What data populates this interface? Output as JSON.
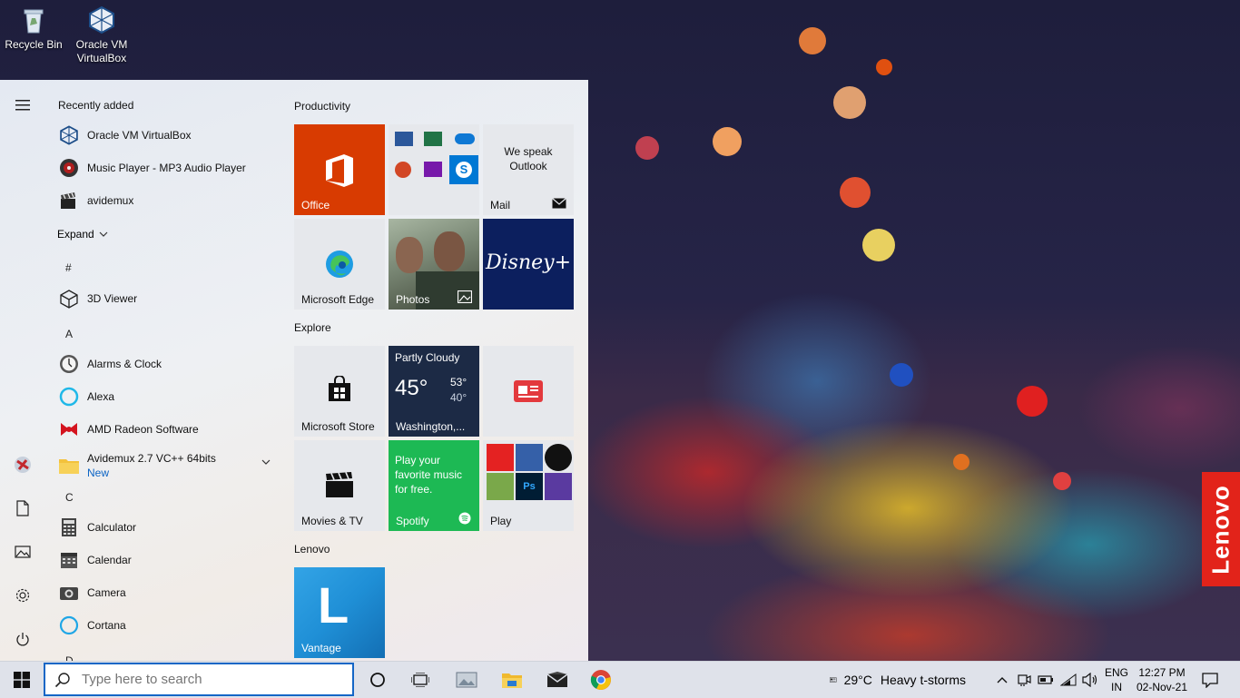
{
  "desktop": {
    "icons": [
      {
        "label": "Recycle Bin"
      },
      {
        "label": "Oracle VM VirtualBox"
      }
    ],
    "badge": "Lenovo"
  },
  "start_menu": {
    "recent_title": "Recently added",
    "recent": [
      {
        "name": "Oracle VM VirtualBox"
      },
      {
        "name": "Music Player - MP3 Audio Player"
      },
      {
        "name": "avidemux"
      }
    ],
    "expand_label": "Expand",
    "letters": [
      "#",
      "A",
      "C",
      "D"
    ],
    "apps": [
      {
        "name": "3D Viewer"
      },
      {
        "name": "Alarms & Clock"
      },
      {
        "name": "Alexa"
      },
      {
        "name": "AMD Radeon Software"
      },
      {
        "name": "Avidemux 2.7 VC++ 64bits",
        "badge": "New"
      },
      {
        "name": "Calculator"
      },
      {
        "name": "Calendar"
      },
      {
        "name": "Camera"
      },
      {
        "name": "Cortana"
      }
    ],
    "groups": {
      "productivity": "Productivity",
      "explore": "Explore",
      "lenovo": "Lenovo"
    },
    "tiles": {
      "office": "Office",
      "mail_promo": "We speak Outlook",
      "mail": "Mail",
      "edge": "Microsoft Edge",
      "photos": "Photos",
      "disney": "Disney+",
      "store": "Microsoft Store",
      "weather_cond": "Partly Cloudy",
      "weather_temp": "45°",
      "weather_high": "53°",
      "weather_low": "40°",
      "weather_loc": "Washington,...",
      "movies": "Movies & TV",
      "spotify_promo": "Play your favorite music for free.",
      "spotify": "Spotify",
      "play": "Play",
      "vantage": "Vantage"
    }
  },
  "taskbar": {
    "search_placeholder": "Type here to search",
    "weather_temp": "29°C",
    "weather_text": "Heavy t-storms",
    "lang": "ENG",
    "region": "IN",
    "time": "12:27 PM",
    "date": "02-Nov-21"
  },
  "colors": {
    "office_tile": "#d83b01",
    "disney_tile": "#0c1f5e",
    "weather_tile": "#1c2a45",
    "spotify_tile": "#1db954",
    "vantage_tile": "#1f8fd6",
    "accent": "#1466c6"
  }
}
